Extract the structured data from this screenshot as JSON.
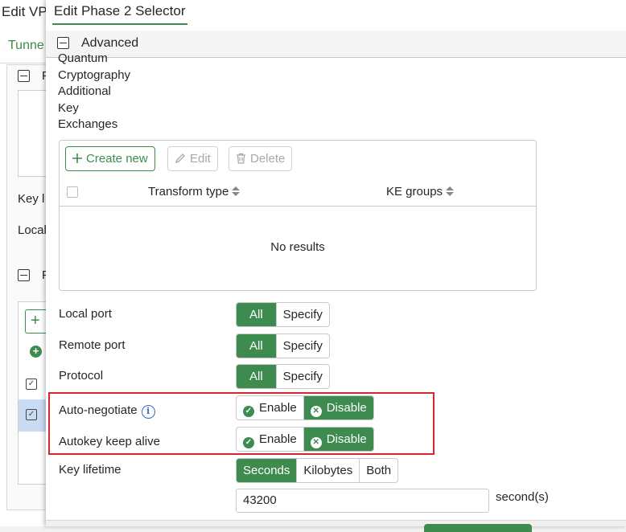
{
  "background_dialog": {
    "title": "Edit VP",
    "tab": "Tunne",
    "section1_title": "P",
    "section2_title": "P",
    "label_key": "Key l",
    "label_local": "Local",
    "add_button": "+"
  },
  "dialog": {
    "title": "Edit Phase 2 Selector",
    "section_title": "Advanced",
    "pqc_label_lines": [
      "Quantum",
      "Cryptography",
      "Additional",
      "Key",
      "Exchanges"
    ],
    "table": {
      "toolbar": {
        "create_new": "Create new",
        "edit": "Edit",
        "delete": "Delete"
      },
      "columns": [
        "Transform type",
        "KE groups"
      ],
      "empty_message": "No results"
    },
    "fields": {
      "local_port": {
        "label": "Local port",
        "options": [
          "All",
          "Specify"
        ],
        "selected": "All"
      },
      "remote_port": {
        "label": "Remote port",
        "options": [
          "All",
          "Specify"
        ],
        "selected": "All"
      },
      "protocol": {
        "label": "Protocol",
        "options": [
          "All",
          "Specify"
        ],
        "selected": "All"
      },
      "auto_negotiate": {
        "label": "Auto-negotiate",
        "enable": "Enable",
        "disable": "Disable",
        "selected": "Disable"
      },
      "autokey_keep_alive": {
        "label": "Autokey keep alive",
        "enable": "Enable",
        "disable": "Disable",
        "selected": "Disable"
      },
      "key_lifetime": {
        "label": "Key lifetime",
        "options": [
          "Seconds",
          "Kilobytes",
          "Both"
        ],
        "selected": "Seconds"
      },
      "lifetime_value": "43200",
      "lifetime_unit": "second(s)"
    }
  },
  "colors": {
    "accent": "#3d8b4f",
    "highlight": "#d9262c",
    "info": "#2d6ec9"
  }
}
